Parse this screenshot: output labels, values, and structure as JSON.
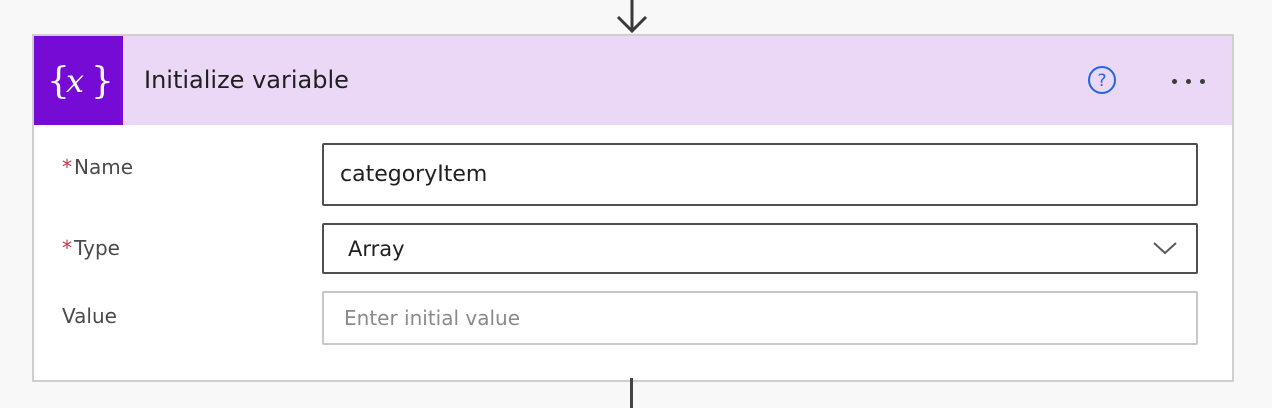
{
  "card": {
    "title": "Initialize variable",
    "icon": "variable-braces-icon",
    "accent_color": "#770bd6",
    "header_color": "#ead8f6"
  },
  "fields": {
    "name": {
      "label": "Name",
      "required_mark": "*",
      "value": "categoryItem"
    },
    "type": {
      "label": "Type",
      "required_mark": "*",
      "value": "Array"
    },
    "value": {
      "label": "Value",
      "placeholder": "Enter initial value",
      "value": ""
    }
  },
  "icons": {
    "help": "help-circle-icon",
    "more": "more-options-icon",
    "dropdown": "chevron-down-icon"
  }
}
